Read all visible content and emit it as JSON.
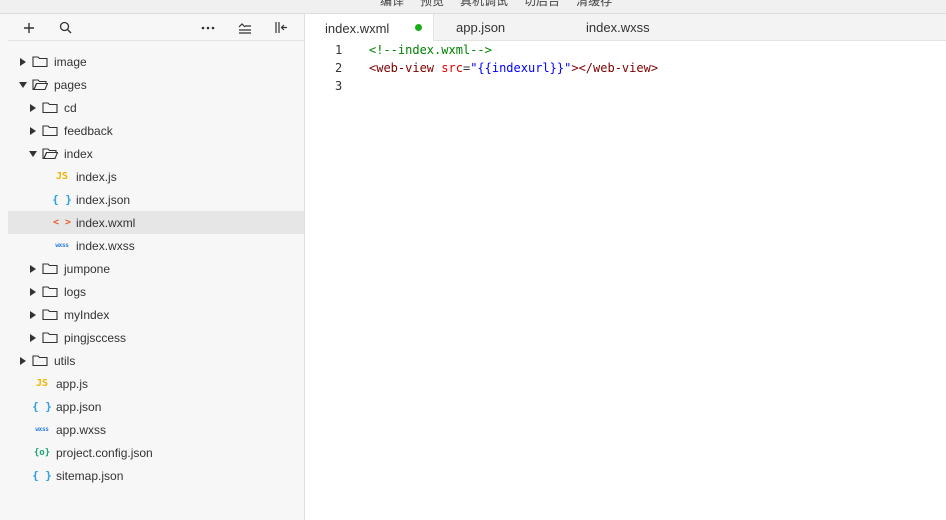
{
  "top_menu": [
    "编译",
    "预览",
    "真机调试",
    "切后台",
    "清缓存"
  ],
  "sidebar": {
    "toolbar": [
      "plus-icon",
      "search-icon",
      "more-icon",
      "collapse-all-icon",
      "toggle-panel-icon"
    ],
    "tree": [
      {
        "label": "image",
        "type": "folder",
        "expanded": false,
        "depth": 0
      },
      {
        "label": "pages",
        "type": "folder",
        "expanded": true,
        "depth": 0
      },
      {
        "label": "cd",
        "type": "folder",
        "expanded": false,
        "depth": 1
      },
      {
        "label": "feedback",
        "type": "folder",
        "expanded": false,
        "depth": 1
      },
      {
        "label": "index",
        "type": "folder",
        "expanded": true,
        "depth": 1
      },
      {
        "label": "index.js",
        "type": "js",
        "depth": 2
      },
      {
        "label": "index.json",
        "type": "json",
        "depth": 2
      },
      {
        "label": "index.wxml",
        "type": "wxml",
        "depth": 2,
        "selected": true
      },
      {
        "label": "index.wxss",
        "type": "wxss",
        "depth": 2
      },
      {
        "label": "jumpone",
        "type": "folder",
        "expanded": false,
        "depth": 1
      },
      {
        "label": "logs",
        "type": "folder",
        "expanded": false,
        "depth": 1
      },
      {
        "label": "myIndex",
        "type": "folder",
        "expanded": false,
        "depth": 1
      },
      {
        "label": "pingjsccess",
        "type": "folder",
        "expanded": false,
        "depth": 1
      },
      {
        "label": "utils",
        "type": "folder",
        "expanded": false,
        "depth": 0
      },
      {
        "label": "app.js",
        "type": "js",
        "depth": 0
      },
      {
        "label": "app.json",
        "type": "json",
        "depth": 0
      },
      {
        "label": "app.wxss",
        "type": "wxss",
        "depth": 0
      },
      {
        "label": "project.config.json",
        "type": "cfg",
        "depth": 0
      },
      {
        "label": "sitemap.json",
        "type": "json",
        "depth": 0
      }
    ],
    "icon_glyphs": {
      "js": "JS",
      "json": "{ }",
      "wxml": "< >",
      "wxss": "wxss",
      "cfg": "{o}"
    }
  },
  "tabs": [
    {
      "label": "index.wxml",
      "active": true,
      "modified": true
    },
    {
      "label": "app.json",
      "active": false
    },
    {
      "label": "index.wxss",
      "active": false
    }
  ],
  "editor": {
    "lines": [
      {
        "number": "1",
        "tokens": [
          {
            "cls": "c-comment",
            "text": "<!--index.wxml-->"
          }
        ]
      },
      {
        "number": "2",
        "tokens": [
          {
            "cls": "c-tag",
            "text": "<web-view"
          },
          {
            "cls": "c-plain",
            "text": " "
          },
          {
            "cls": "c-attr",
            "text": "src"
          },
          {
            "cls": "c-plain",
            "text": "="
          },
          {
            "cls": "c-str",
            "text": "\"{{indexurl}}\""
          },
          {
            "cls": "c-tag",
            "text": "></web-view>"
          }
        ]
      },
      {
        "number": "3",
        "tokens": []
      }
    ]
  },
  "colors": {
    "accent": "#1aad19",
    "selected_row": "#e6e6e6",
    "sidebar_bg": "#f7f7f7"
  }
}
